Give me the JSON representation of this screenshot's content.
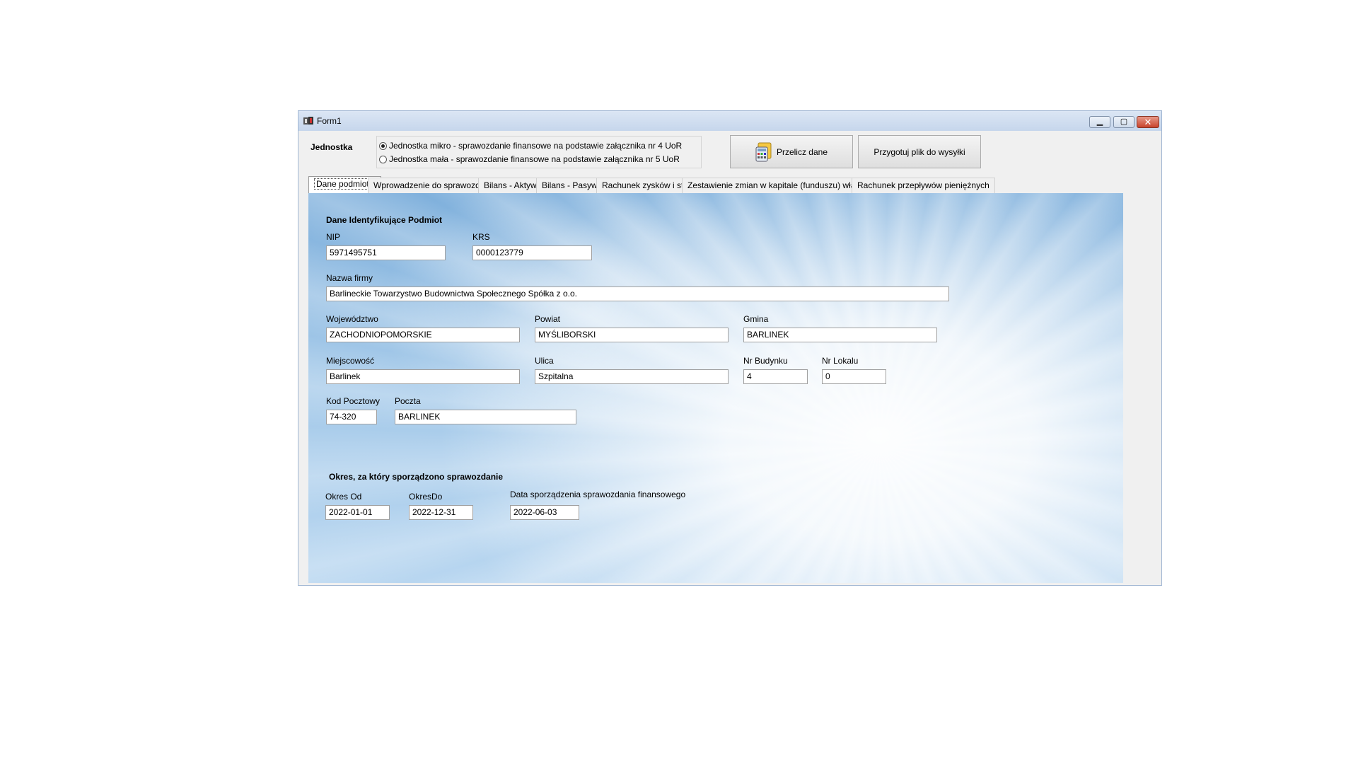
{
  "window": {
    "title": "Form1"
  },
  "jednostka": {
    "label": "Jednostka",
    "options": [
      {
        "label": "Jednostka mikro - sprawozdanie finansowe na podstawie załącznika nr 4 UoR",
        "selected": true
      },
      {
        "label": "Jednostka mała - sprawozdanie finansowe na podstawie załącznika nr 5 UoR",
        "selected": false
      }
    ]
  },
  "buttons": {
    "przelicz": "Przelicz dane",
    "przygotuj": "Przygotuj plik do wysyłki"
  },
  "tabs": [
    "Dane podmiotu",
    "Wprowadzenie do sprawozdania",
    "Bilans - Aktywa",
    "Bilans - Pasywa",
    "Rachunek zysków i strat",
    "Zestawienie zmian w kapitale (funduszu) własnym",
    "Rachunek przepływów pieniężnych"
  ],
  "dane": {
    "section_title": "Dane Identyfikujące Podmiot",
    "nip": {
      "label": "NIP",
      "value": "5971495751"
    },
    "krs": {
      "label": "KRS",
      "value": "0000123779"
    },
    "nazwa": {
      "label": "Nazwa firmy",
      "value": "Barlineckie Towarzystwo Budownictwa Społecznego Spółka z o.o."
    },
    "wojewodztwo": {
      "label": "Województwo",
      "value": "ZACHODNIOPOMORSKIE"
    },
    "powiat": {
      "label": "Powiat",
      "value": "MYŚLIBORSKI"
    },
    "gmina": {
      "label": "Gmina",
      "value": "BARLINEK"
    },
    "miejscowosc": {
      "label": "Miejscowość",
      "value": "Barlinek"
    },
    "ulica": {
      "label": "Ulica",
      "value": "Szpitalna"
    },
    "nr_budynku": {
      "label": "Nr Budynku",
      "value": "4"
    },
    "nr_lokalu": {
      "label": "Nr Lokalu",
      "value": "0"
    },
    "kod": {
      "label": "Kod Pocztowy",
      "value": "74-320"
    },
    "poczta": {
      "label": "Poczta",
      "value": "BARLINEK"
    }
  },
  "okres": {
    "section_title": "Okres, za który sporządzono sprawozdanie",
    "od": {
      "label": "Okres Od",
      "value": "2022-01-01"
    },
    "do": {
      "label": "OkresDo",
      "value": "2022-12-31"
    },
    "data_sporzadzenia": {
      "label": "Data sporządzenia sprawozdania finansowego",
      "value": "2022-06-03"
    }
  }
}
